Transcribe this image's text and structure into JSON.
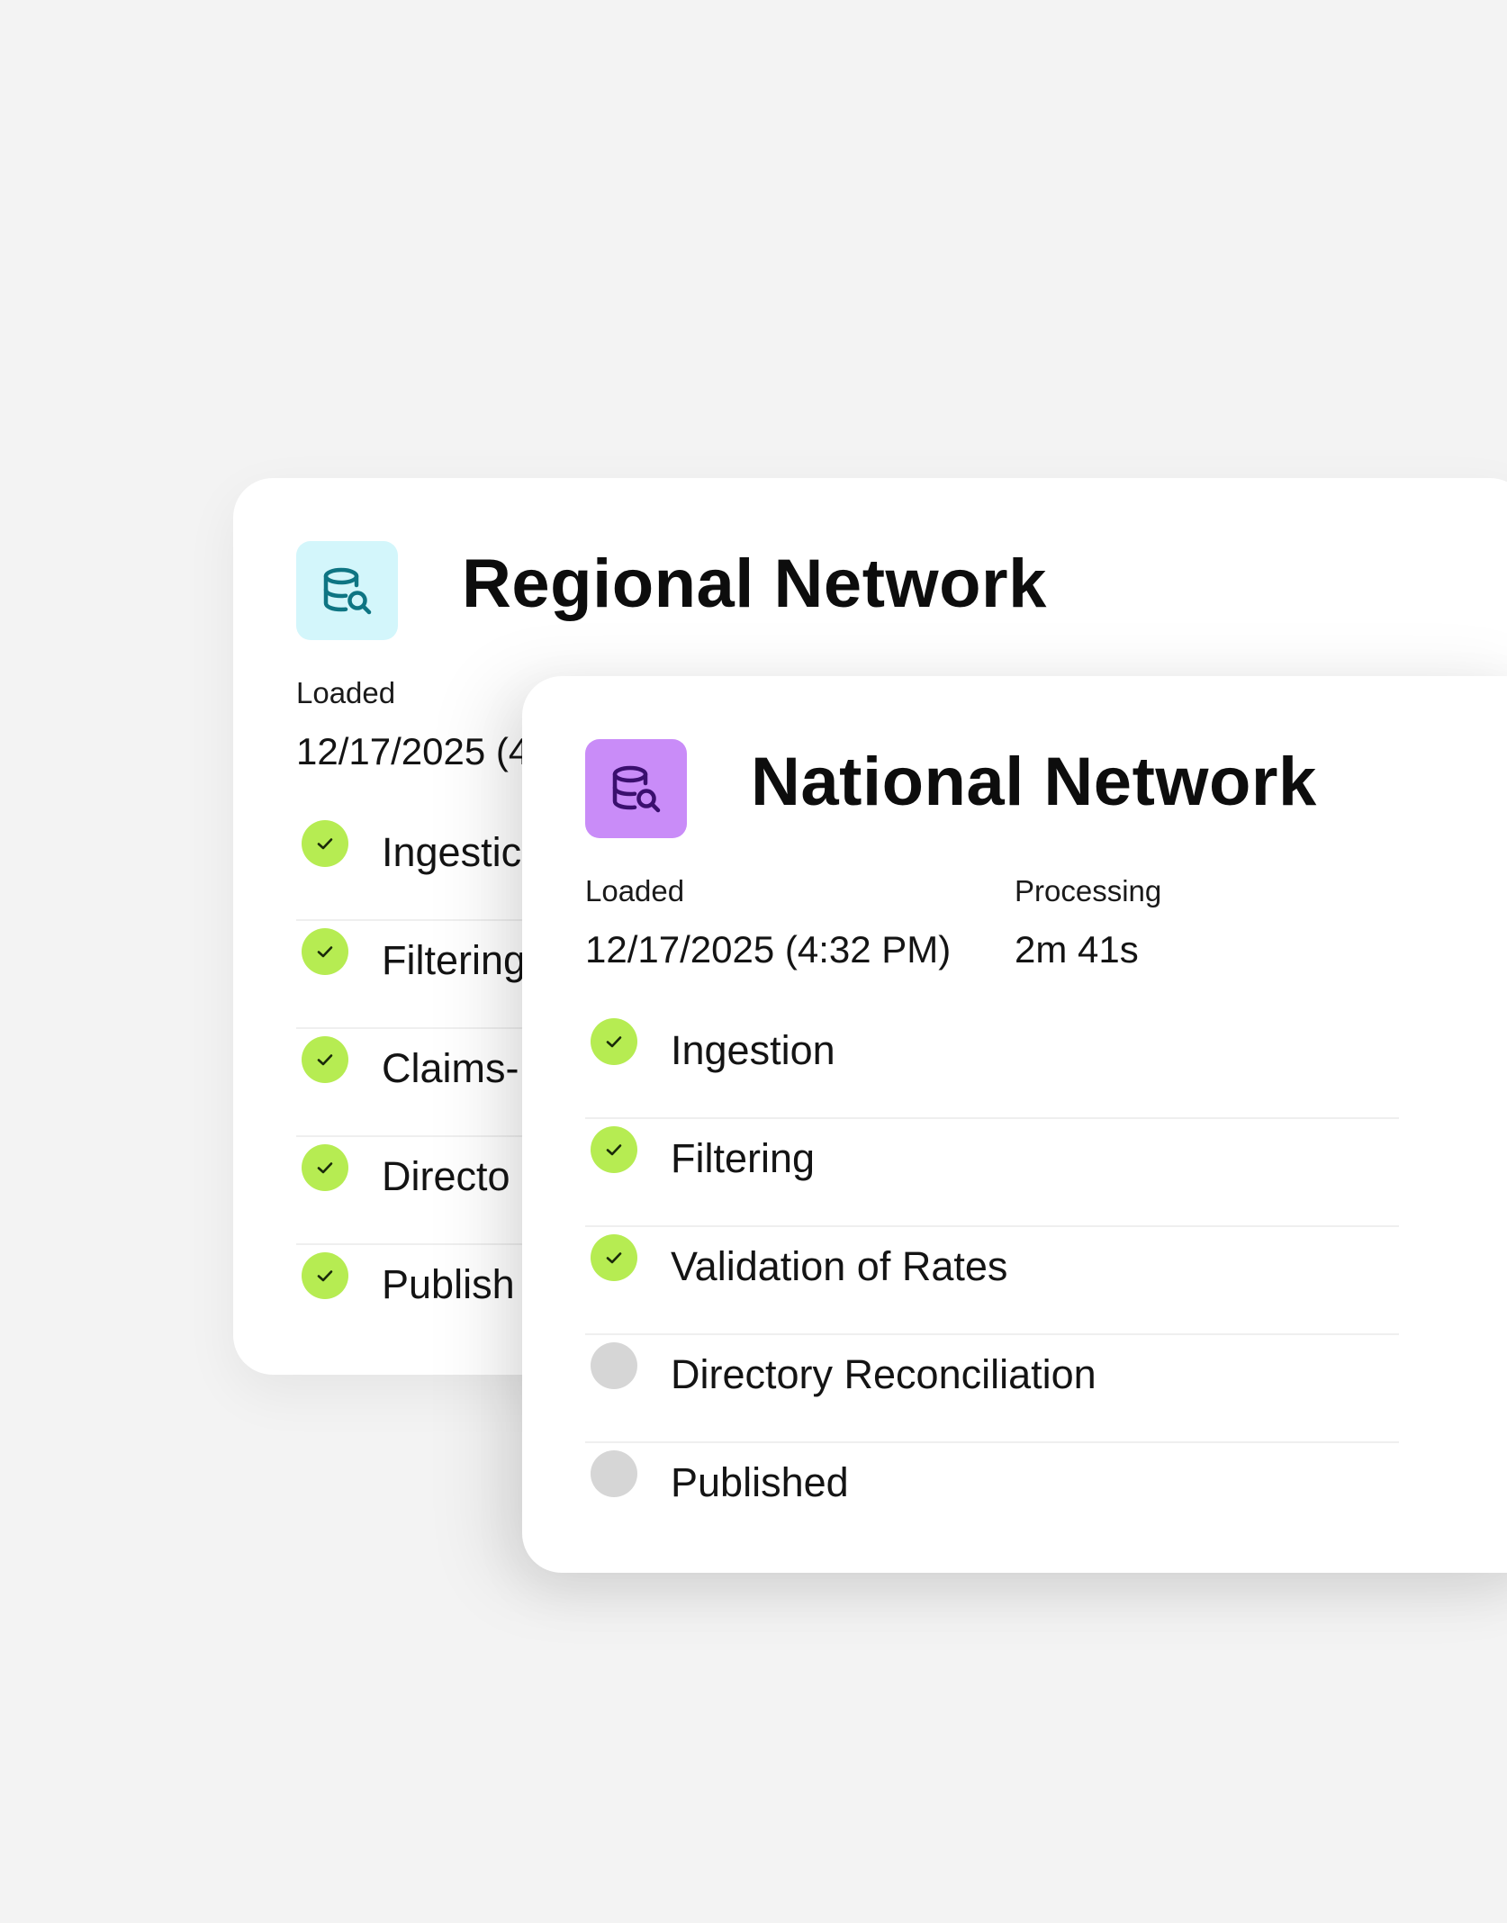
{
  "colors": {
    "page_bg": "#f3f3f3",
    "card_bg": "#ffffff",
    "done": "#b6ec52",
    "pending": "#d6d6d6",
    "regional_tile": "#d3f6fb",
    "regional_icon": "#0e7583",
    "national_tile": "#c98cf8",
    "national_icon": "#3a0f6e"
  },
  "regional": {
    "icon": "database-search-icon",
    "title": "Regional Network",
    "loaded_label": "Loaded",
    "loaded_value": "12/17/2025 (4",
    "steps": [
      {
        "label": "Ingestic",
        "status": "done"
      },
      {
        "label": "Filtering",
        "status": "done"
      },
      {
        "label": "Claims-",
        "status": "done"
      },
      {
        "label": "Directo",
        "status": "done"
      },
      {
        "label": "Publish",
        "status": "done"
      }
    ]
  },
  "national": {
    "icon": "database-search-icon",
    "title": "National Network",
    "loaded_label": "Loaded",
    "loaded_value": "12/17/2025 (4:32 PM)",
    "processing_label": "Processing",
    "processing_value": "2m 41s",
    "steps": [
      {
        "label": "Ingestion",
        "status": "done"
      },
      {
        "label": "Filtering",
        "status": "done"
      },
      {
        "label": "Validation of Rates",
        "status": "done"
      },
      {
        "label": "Directory Reconciliation",
        "status": "pending"
      },
      {
        "label": "Published",
        "status": "pending"
      }
    ]
  }
}
